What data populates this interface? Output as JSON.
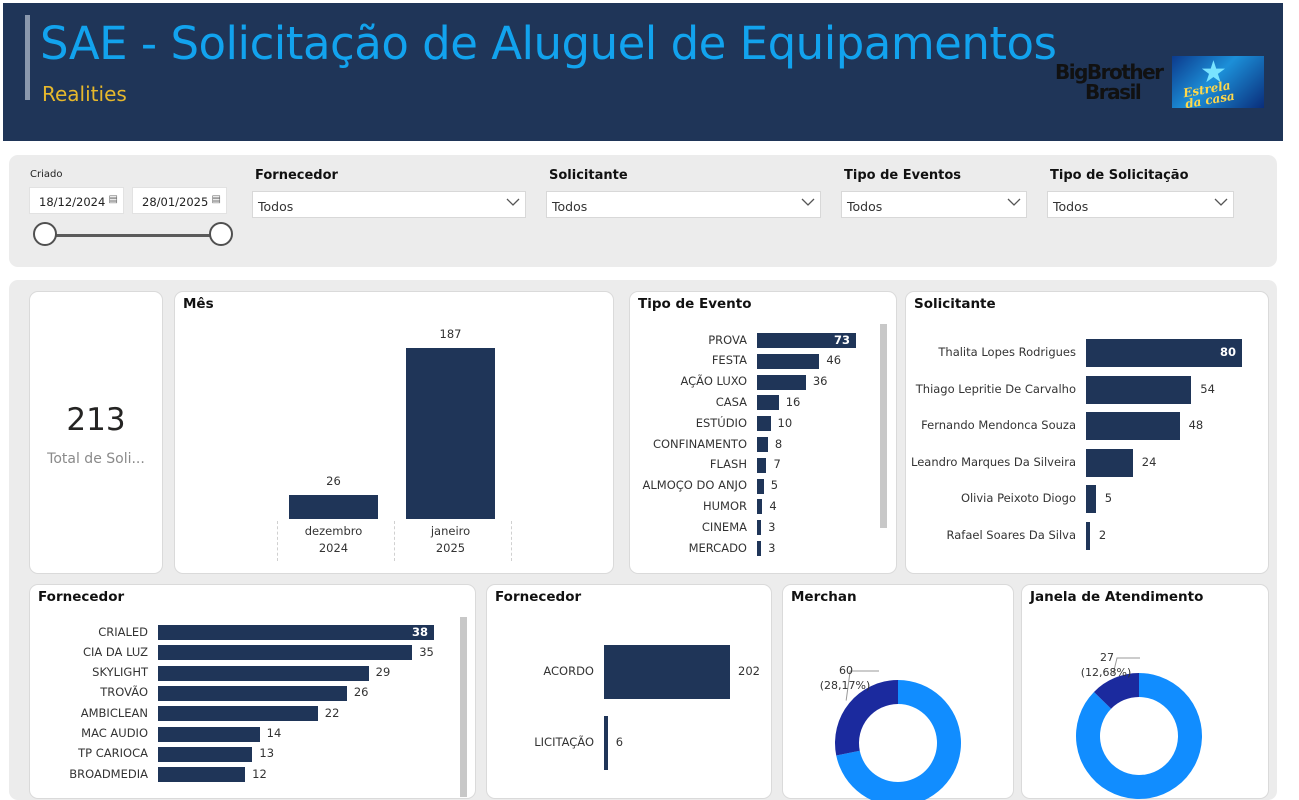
{
  "header": {
    "title": "SAE - Solicitação de Aluguel de Equipamentos",
    "subtitle": "Realities",
    "logo_bbb": "BigBrotherBrasil",
    "logo_estrela": "Estrela da casa",
    "colors": {
      "bg": "#1f3558",
      "title": "#12a3ee",
      "subtitle": "#e6b82c"
    }
  },
  "filters": {
    "criado": {
      "label": "Criado",
      "start": "18/12/2024",
      "end": "28/01/2025",
      "icon": "calendar-icon"
    },
    "fornecedor": {
      "label": "Fornecedor",
      "value": "Todos"
    },
    "solicitante": {
      "label": "Solicitante",
      "value": "Todos"
    },
    "tipo_eventos": {
      "label": "Tipo de Eventos",
      "value": "Todos"
    },
    "tipo_solicitacao": {
      "label": "Tipo de Solicitação",
      "value": "Todos"
    }
  },
  "kpi": {
    "value": "213",
    "label": "Total de Soli..."
  },
  "charts": {
    "mes": {
      "title": "Mês",
      "chart_data": {
        "type": "bar",
        "categories": [
          [
            "dezembro",
            "2024"
          ],
          [
            "janeiro",
            "2025"
          ]
        ],
        "values": [
          26,
          187
        ],
        "ylim": [
          0,
          187
        ]
      }
    },
    "tipo_evento": {
      "title": "Tipo de Evento",
      "chart_data": {
        "type": "bar",
        "orientation": "horizontal",
        "categories": [
          "PROVA",
          "FESTA",
          "AÇÃO LUXO",
          "CASA",
          "ESTÚDIO",
          "CONFINAMENTO",
          "FLASH",
          "ALMOÇO DO ANJO",
          "HUMOR",
          "CINEMA",
          "MERCADO"
        ],
        "values": [
          73,
          46,
          36,
          16,
          10,
          8,
          7,
          5,
          4,
          3,
          3
        ],
        "xlim": [
          0,
          73
        ]
      }
    },
    "solicitante": {
      "title": "Solicitante",
      "chart_data": {
        "type": "bar",
        "orientation": "horizontal",
        "categories": [
          "Thalita Lopes Rodrigues",
          "Thiago Lepritie De Carvalho",
          "Fernando Mendonca Souza",
          "Leandro Marques Da Silveira",
          "Olivia Peixoto Diogo",
          "Rafael Soares Da Silva"
        ],
        "values": [
          80,
          54,
          48,
          24,
          5,
          2
        ],
        "xlim": [
          0,
          80
        ]
      }
    },
    "fornecedor": {
      "title": "Fornecedor",
      "chart_data": {
        "type": "bar",
        "orientation": "horizontal",
        "categories": [
          "CRIALED",
          "CIA DA LUZ",
          "SKYLIGHT",
          "TROVÃO",
          "AMBICLEAN",
          "MAC AUDIO",
          "TP CARIOCA",
          "BROADMEDIA"
        ],
        "values": [
          38,
          35,
          29,
          26,
          22,
          14,
          13,
          12
        ],
        "xlim": [
          0,
          38
        ]
      }
    },
    "fornecedor_tipo": {
      "title": "Fornecedor",
      "chart_data": {
        "type": "bar",
        "orientation": "horizontal",
        "categories": [
          "ACORDO",
          "LICITAÇÃO"
        ],
        "values": [
          202,
          6
        ],
        "xlim": [
          0,
          202
        ]
      }
    },
    "merchan": {
      "title": "Merchan",
      "chart_data": {
        "type": "pie",
        "donut": true,
        "slices": [
          {
            "value": 60,
            "label": "60",
            "pct": "(28,17%)",
            "color": "#1b2a9e"
          },
          {
            "value": 153,
            "label": "",
            "pct": "",
            "color": "#118dff"
          }
        ]
      }
    },
    "janela": {
      "title": "Janela de Atendimento",
      "chart_data": {
        "type": "pie",
        "donut": true,
        "slices": [
          {
            "value": 27,
            "label": "27",
            "pct": "(12,68%)",
            "color": "#1b2a9e"
          },
          {
            "value": 186,
            "label": "",
            "pct": "",
            "color": "#118dff"
          }
        ]
      }
    }
  },
  "bar_color": "#1f3558"
}
